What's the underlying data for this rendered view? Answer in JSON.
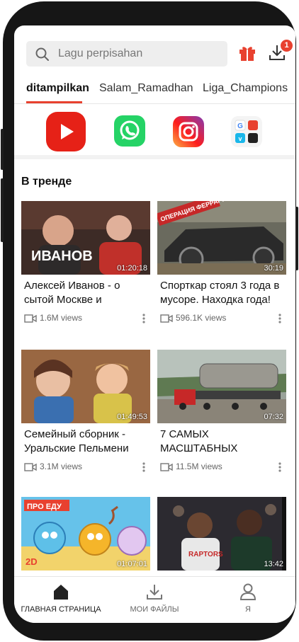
{
  "search": {
    "placeholder": "Lagu perpisahan"
  },
  "header": {
    "download_badge": "1"
  },
  "tabs": [
    {
      "label": "ditampilkan",
      "active": true
    },
    {
      "label": "Salam_Ramadhan",
      "active": false
    },
    {
      "label": "Liga_Champions",
      "active": false
    }
  ],
  "apps": [
    {
      "icon": "youtube-icon"
    },
    {
      "icon": "whatsapp-icon"
    },
    {
      "icon": "instagram-icon"
    },
    {
      "icon": "more-apps-icon"
    }
  ],
  "section": {
    "title": "В тренде"
  },
  "videos": [
    {
      "title": "Алексей Иванов - о сытой Москве и",
      "duration": "01:20:18",
      "views": "1.6M views",
      "thumb_text": "ИВАНОВ"
    },
    {
      "title": "Спорткар стоял 3 года в мусоре. Находка года!",
      "duration": "30:19",
      "views": "596.1K views",
      "thumb_text": "ОПЕРАЦИЯ ФЕРРАРИ"
    },
    {
      "title": "Семейный сборник - Уральские Пельмени",
      "duration": "01:49:53",
      "views": "3.1M views",
      "thumb_text": ""
    },
    {
      "title": "7 САМЫХ МАСШТАБНЫХ",
      "duration": "07:32",
      "views": "11.5M views",
      "thumb_text": ""
    },
    {
      "title": "",
      "duration": "01:07:01",
      "views": "",
      "thumb_text": "ПРО ЕДУ"
    },
    {
      "title": "",
      "duration": "13:42",
      "views": "",
      "thumb_text": ""
    }
  ],
  "thumb_badges": {
    "cartoon_2d": "2D"
  },
  "bottom_nav": [
    {
      "label": "ГЛАВНАЯ СТРАНИЦА",
      "icon": "home-icon",
      "active": true
    },
    {
      "label": "МОИ ФАЙЛЫ",
      "icon": "download-icon",
      "active": false
    },
    {
      "label": "Я",
      "icon": "user-icon",
      "active": false
    }
  ],
  "colors": {
    "accent": "#e8412f",
    "youtube": "#e62117",
    "whatsapp": "#25d366"
  }
}
